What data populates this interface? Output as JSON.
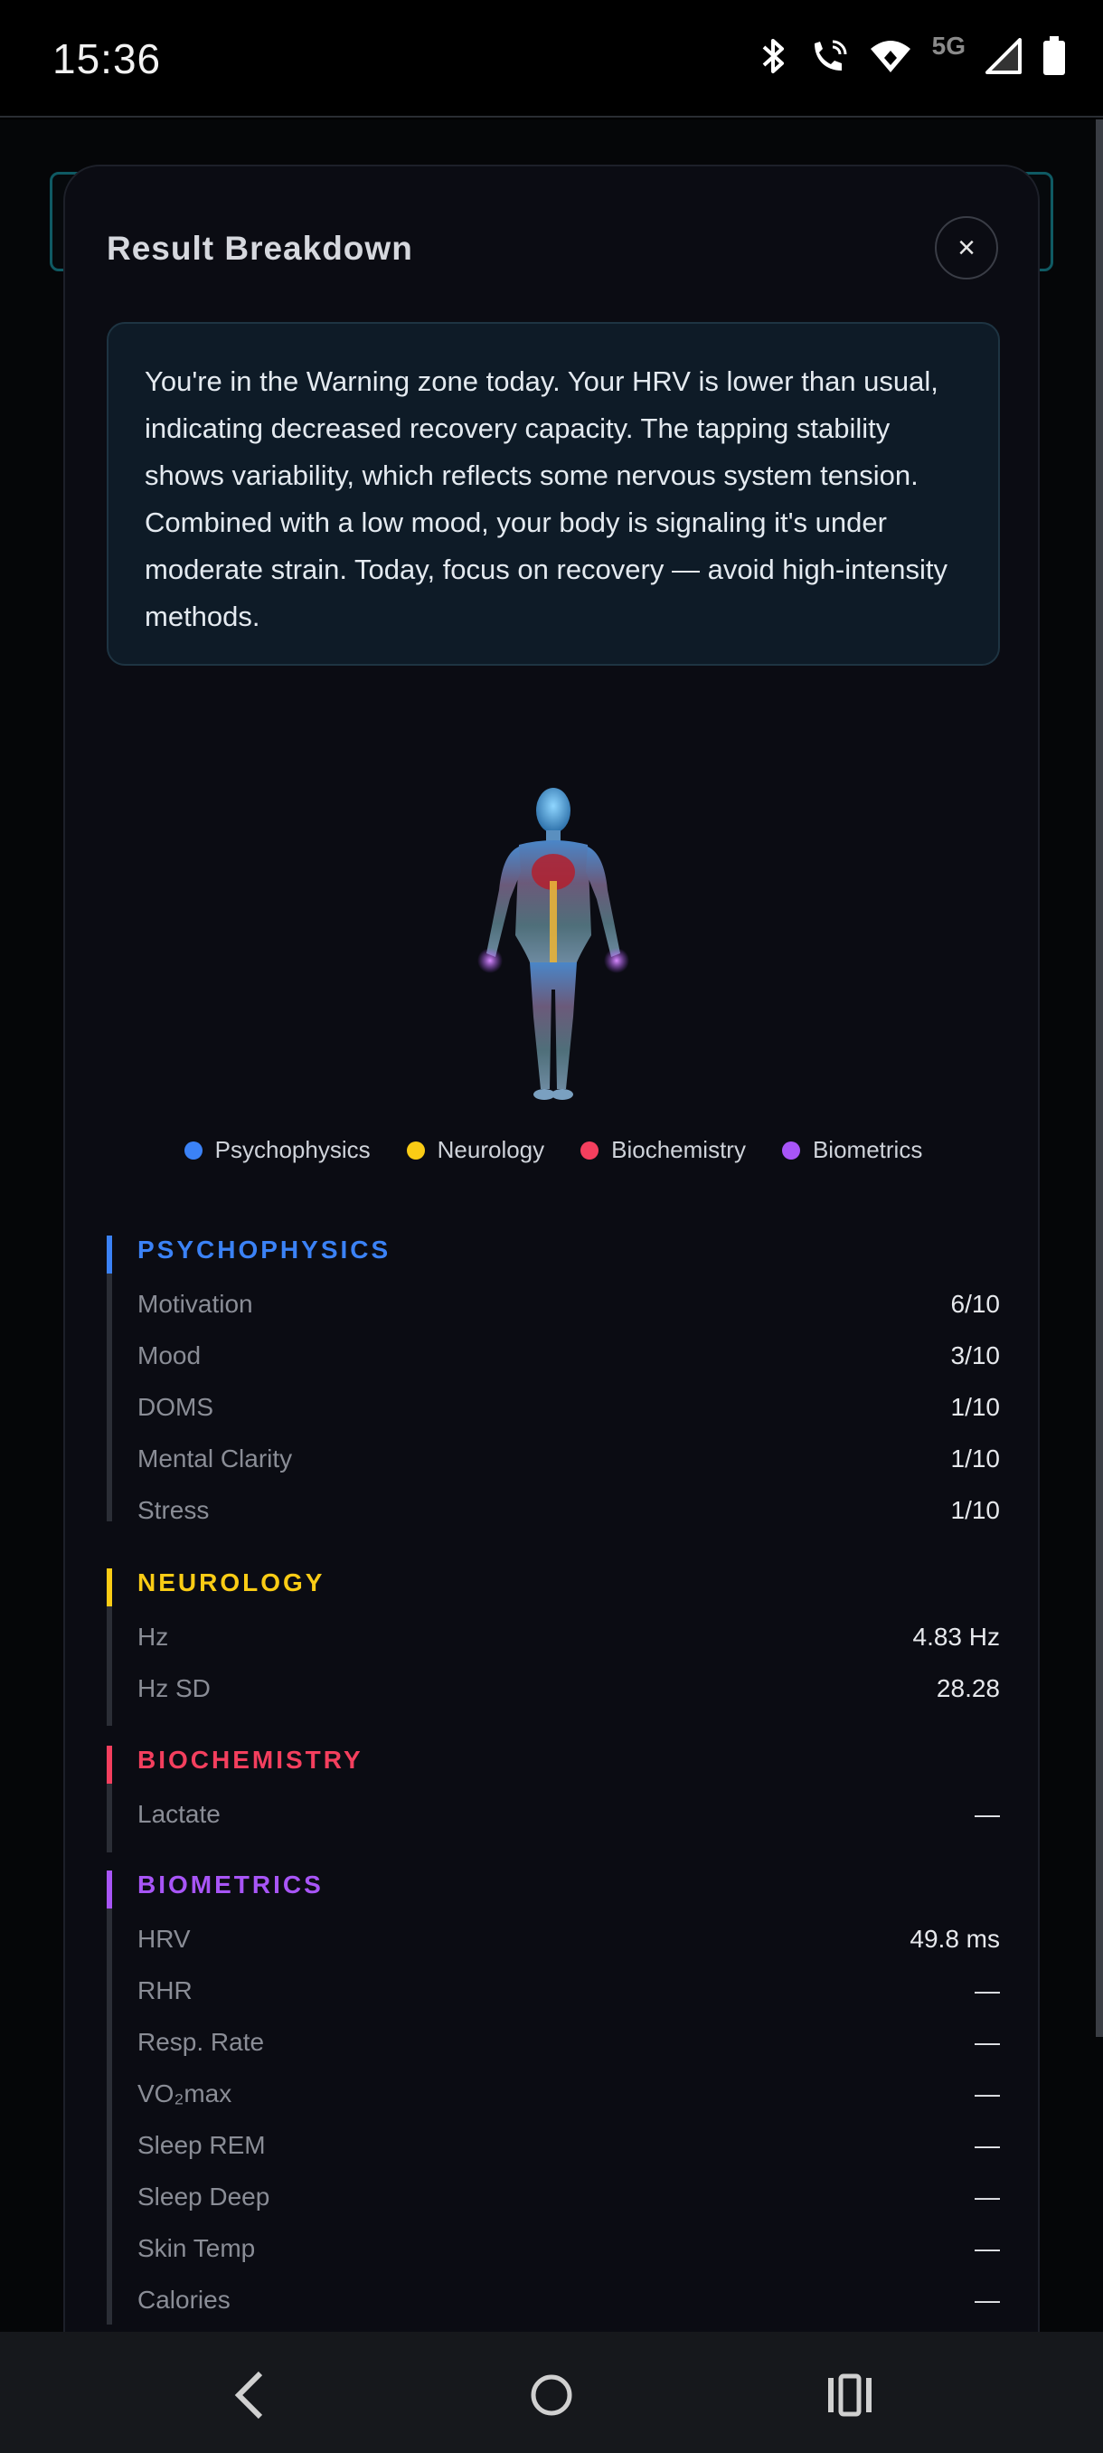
{
  "status_bar": {
    "time": "15:36",
    "network": "5G",
    "icons": [
      "bluetooth-icon",
      "wifi-calling-icon",
      "wifi-icon",
      "signal-icon",
      "battery-icon"
    ]
  },
  "modal": {
    "title": "Result Breakdown",
    "close_label": "×",
    "summary": "You're in the Warning zone today. Your HRV is lower than usual, indicating decreased recovery capacity. The tapping stability shows variability, which reflects some nervous system tension. Combined with a low mood, your body is signaling it's under moderate strain. Today, focus on recovery — avoid high-intensity methods."
  },
  "legend": [
    {
      "label": "Psychophysics",
      "color": "#3b82f6"
    },
    {
      "label": "Neurology",
      "color": "#facc15"
    },
    {
      "label": "Biochemistry",
      "color": "#f43f5e"
    },
    {
      "label": "Biometrics",
      "color": "#a855f7"
    }
  ],
  "sections": {
    "psychophysics": {
      "title": "PSYCHOPHYSICS",
      "color": "#3b82f6",
      "rows": [
        {
          "label": "Motivation",
          "value": "6/10"
        },
        {
          "label": "Mood",
          "value": "3/10"
        },
        {
          "label": "DOMS",
          "value": "1/10"
        },
        {
          "label": "Mental Clarity",
          "value": "1/10"
        },
        {
          "label": "Stress",
          "value": "1/10"
        }
      ]
    },
    "neurology": {
      "title": "NEUROLOGY",
      "color": "#facc15",
      "rows": [
        {
          "label": "Hz",
          "value": "4.83 Hz"
        },
        {
          "label": "Hz SD",
          "value": "28.28"
        }
      ]
    },
    "biochemistry": {
      "title": "BIOCHEMISTRY",
      "color": "#f43f5e",
      "rows": [
        {
          "label": "Lactate",
          "value": "—"
        }
      ]
    },
    "biometrics": {
      "title": "BIOMETRICS",
      "color": "#a855f7",
      "rows": [
        {
          "label": "HRV",
          "value": "49.8 ms"
        },
        {
          "label": "RHR",
          "value": "—"
        },
        {
          "label": "Resp. Rate",
          "value": "—"
        },
        {
          "label": "VO₂max",
          "value": "—"
        },
        {
          "label": "Sleep REM",
          "value": "—"
        },
        {
          "label": "Sleep Deep",
          "value": "—"
        },
        {
          "label": "Skin Temp",
          "value": "—"
        },
        {
          "label": "Calories",
          "value": "—"
        }
      ]
    }
  }
}
